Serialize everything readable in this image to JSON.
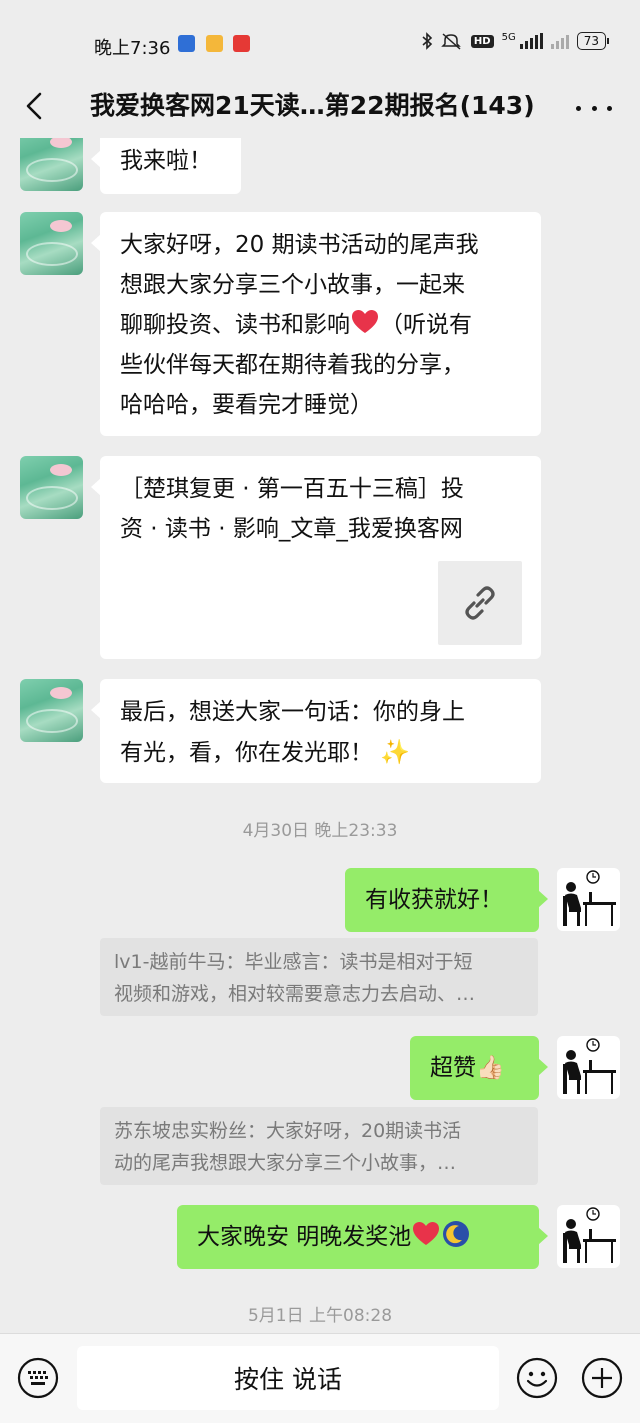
{
  "status_bar": {
    "time": "晚上7:36",
    "network": "5G",
    "hd": "HD",
    "battery": "73"
  },
  "header": {
    "title": "我爱换客网21天读…第22期报名(143)"
  },
  "messages": {
    "m1": {
      "text": "我来啦！"
    },
    "m2": {
      "lines": [
        "大家好呀，20 期读书活动的尾声我",
        "想跟大家分享三个小故事，一起来",
        "聊聊投资、读书和影响",
        "（听说有",
        "些伙伴每天都在期待着我的分享，",
        "哈哈哈，要看完才睡觉）"
      ]
    },
    "m3": {
      "lines": [
        "［楚琪复更 · 第一百五十三稿］投",
        "资 · 读书 · 影响_文章_我爱换客网"
      ]
    },
    "m4": {
      "lines": [
        "最后，想送大家一句话：你的身上",
        "有光，看，你在发光耶！"
      ]
    },
    "ts1": "4月30日 晚上23:33",
    "m5": {
      "text": "有收获就好！"
    },
    "q1": {
      "lines": [
        "lv1-越前牛马：毕业感言：读书是相对于短",
        "视频和游戏，相对较需要意志力去启动、…"
      ]
    },
    "m6": {
      "text": "超赞👍🏻"
    },
    "q2": {
      "lines": [
        "苏东坡忠实粉丝：大家好呀，20期读书活",
        "动的尾声我想跟大家分享三个小故事，…"
      ]
    },
    "m7": {
      "text": "大家晚安 明晚发奖池"
    },
    "ts2": "5月1日 上午08:28"
  },
  "input_bar": {
    "hold_to_talk": "按住 说话"
  },
  "colors": {
    "background": "#ededed",
    "incoming_bubble": "#ffffff",
    "outgoing_bubble": "#95ec69",
    "quote_bg": "#e2e2e2",
    "heart": "#e8334a"
  },
  "icons": [
    "back-icon",
    "more-icon",
    "link-icon",
    "keyboard-icon",
    "emoji-icon",
    "plus-icon",
    "heart-emoji-icon",
    "sparkle-emoji-icon",
    "moon-emoji-icon"
  ]
}
